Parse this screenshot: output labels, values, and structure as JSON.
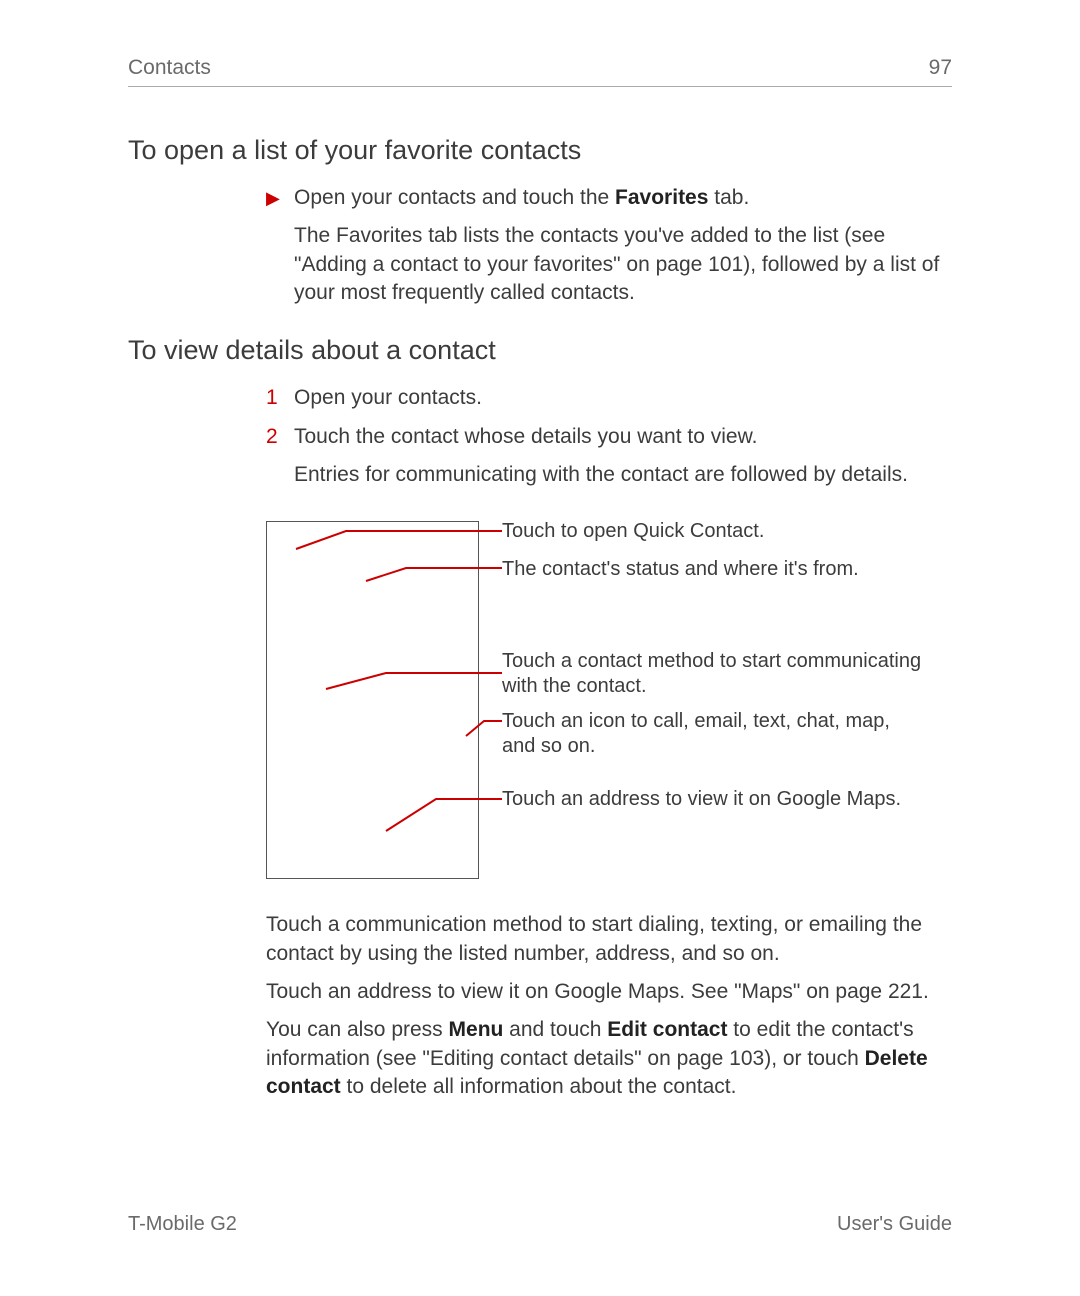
{
  "header": {
    "left": "Contacts",
    "right": "97"
  },
  "h1": "To open a list of your favorite contacts",
  "fav": {
    "line1a": "Open your contacts and touch the ",
    "line1b": "Favorites",
    "line1c": "  tab.",
    "para": "The Favorites tab lists the contacts you've added to the list (see \"Adding a contact to your favorites\" on page 101), followed by a list of your most frequently called contacts."
  },
  "h2": "To view details about a contact",
  "steps": {
    "n1": "1",
    "t1": "Open your contacts.",
    "n2": "2",
    "t2": "Touch the contact whose details you want to view.",
    "t2b": "Entries for communicating with the contact are followed by details."
  },
  "callouts": {
    "c1": "Touch to open Quick Contact.",
    "c2": "The contact's status and where it's from.",
    "c3": "Touch a contact method to start communicating with the contact.",
    "c4": "Touch an icon to call, email, text, chat, map, and so on.",
    "c5": "Touch an address to view it on Google Maps."
  },
  "after": {
    "p1": "Touch a communication method to start dialing, texting, or emailing the contact by using the listed number, address, and so on.",
    "p2": "Touch an address to view it on Google Maps. See \"Maps\" on page 221.",
    "p3a": "You can also press ",
    "p3b": "Menu",
    "p3c": " and touch ",
    "p3d": "Edit contact",
    "p3e": "  to edit the contact's information (see \"Editing contact details\" on page 103), or touch ",
    "p3f": "Delete contact",
    "p3g": "  to delete all information about the contact."
  },
  "footer": {
    "left": "T-Mobile G2",
    "right": "User's Guide"
  }
}
